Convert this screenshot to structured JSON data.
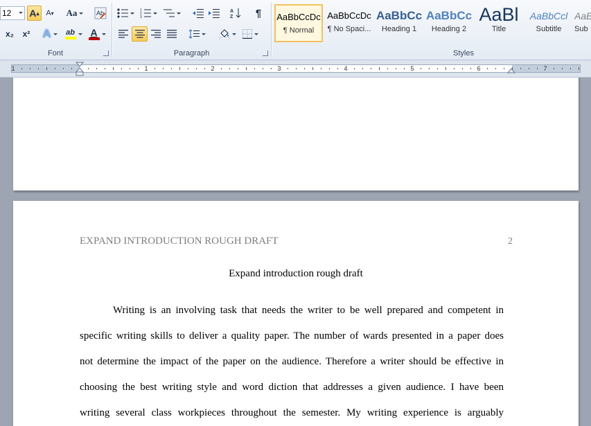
{
  "ribbon": {
    "font_group": {
      "label": "Font",
      "size_value": "12",
      "grow_label": "A",
      "shrink_label": "A",
      "case_label": "Aa",
      "subscript_label": "x₂",
      "superscript_label": "x²",
      "text_effects_label": "A",
      "highlight_label": "ab",
      "font_color_label": "A",
      "font_color_hex": "#c00000",
      "highlight_hex": "#ffff00"
    },
    "paragraph_group": {
      "label": "Paragraph",
      "show_marks_label": "¶"
    },
    "styles_group": {
      "label": "Styles",
      "items": [
        {
          "sample": "AaBbCcDc",
          "name": "¶ Normal"
        },
        {
          "sample": "AaBbCcDc",
          "name": "¶ No Spaci..."
        },
        {
          "sample": "AaBbCc",
          "name": "Heading 1"
        },
        {
          "sample": "AaBbCc",
          "name": "Heading 2"
        },
        {
          "sample": "AaBl",
          "name": "Title"
        },
        {
          "sample": "AaBbCcl",
          "name": "Subtitle"
        },
        {
          "sample": "AaBl",
          "name": "Sub"
        }
      ]
    }
  },
  "ruler": {
    "numbers": [
      "1",
      "1",
      "2",
      "3",
      "4",
      "5",
      "6",
      "7"
    ]
  },
  "document": {
    "running_head": "EXPAND INTRODUCTION ROUGH DRAFT",
    "page_number": "2",
    "title": "Expand introduction rough draft",
    "lines": [
      "Writing is an involving task that needs the writer to be well prepared and competent in",
      "specific writing skills to deliver a quality paper. The number of wards presented in a paper does",
      "not determine the impact of the paper on the audience. Therefore a writer should be effective in",
      "choosing the best writing style and word diction that addresses a given audience. I have been",
      "writing several class workpieces throughout the semester. My writing experience is arguably"
    ]
  }
}
